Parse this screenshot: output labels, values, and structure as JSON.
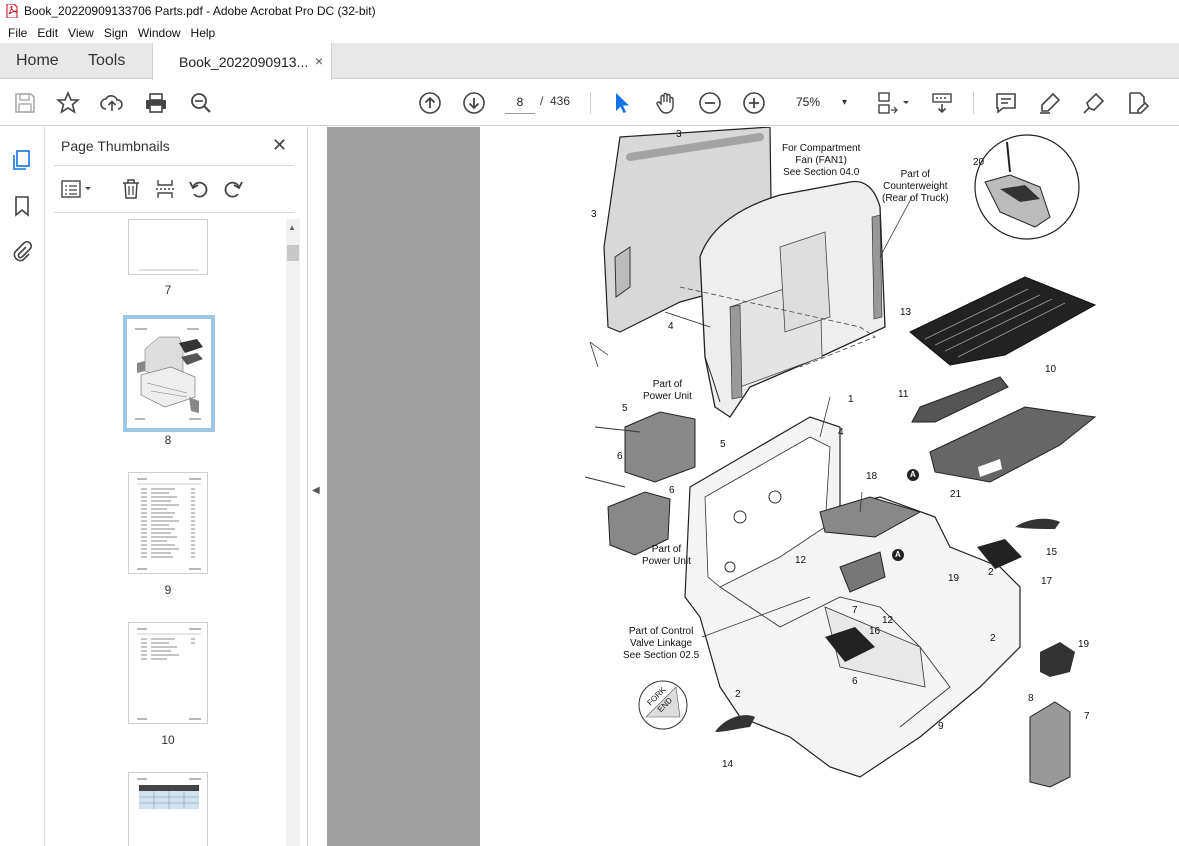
{
  "window": {
    "title": "Book_20220909133706 Parts.pdf - Adobe Acrobat Pro DC (32-bit)"
  },
  "menu": [
    "File",
    "Edit",
    "View",
    "Sign",
    "Window",
    "Help"
  ],
  "tabs": {
    "home": "Home",
    "tools": "Tools",
    "document": "Book_2022090913...",
    "close": "×"
  },
  "toolbar": {
    "current_page": "8",
    "page_separator": "/",
    "total_pages": "436",
    "zoom": "75%",
    "zoom_caret": "▾"
  },
  "thumb_panel": {
    "title": "Page Thumbnails",
    "close": "✕",
    "pages": [
      "7",
      "8",
      "9",
      "10"
    ]
  },
  "drawing": {
    "callouts": [
      {
        "text": "3"
      },
      {
        "text": "3"
      },
      {
        "text": "4"
      },
      {
        "text": "5"
      },
      {
        "text": "5"
      },
      {
        "text": "6"
      },
      {
        "text": "6"
      },
      {
        "text": "1"
      },
      {
        "text": "4"
      },
      {
        "text": "18"
      },
      {
        "text": "21"
      },
      {
        "text": "13"
      },
      {
        "text": "11"
      },
      {
        "text": "10"
      },
      {
        "text": "20"
      },
      {
        "text": "15"
      },
      {
        "text": "17"
      },
      {
        "text": "2"
      },
      {
        "text": "19"
      },
      {
        "text": "12"
      },
      {
        "text": "12"
      },
      {
        "text": "7"
      },
      {
        "text": "16"
      },
      {
        "text": "2"
      },
      {
        "text": "19"
      },
      {
        "text": "6"
      },
      {
        "text": "2"
      },
      {
        "text": "8"
      },
      {
        "text": "9"
      },
      {
        "text": "7"
      },
      {
        "text": "14"
      },
      {
        "text": "A"
      },
      {
        "text": "A"
      }
    ],
    "notes": [
      {
        "text": "For Compartment\nFan (FAN1)\nSee Section 04.0"
      },
      {
        "text": "Part of\nCounterweight\n(Rear of Truck)"
      },
      {
        "text": "Part of\nPower Unit"
      },
      {
        "text": "Part of\nPower Unit"
      },
      {
        "text": "Part of Control\nValve Linkage\nSee Section 02.5"
      },
      {
        "text": "FORK\nEND"
      }
    ]
  }
}
